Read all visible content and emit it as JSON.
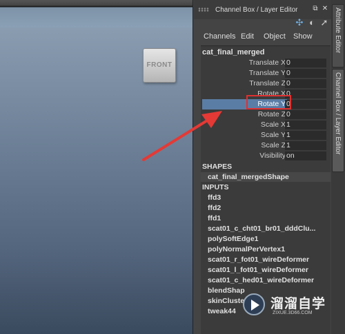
{
  "panel": {
    "title": "Channel Box / Layer Editor",
    "menus": [
      "Channels",
      "Edit",
      "Object",
      "Show"
    ]
  },
  "viewport": {
    "viewcube_label": "FRONT"
  },
  "channel_box": {
    "object_name": "cat_final_merged",
    "attributes": [
      {
        "label": "Translate X",
        "value": "0"
      },
      {
        "label": "Translate Y",
        "value": "0"
      },
      {
        "label": "Translate Z",
        "value": "0"
      },
      {
        "label": "Rotate X",
        "value": "0"
      },
      {
        "label": "Rotate Y",
        "value": "0"
      },
      {
        "label": "Rotate Z",
        "value": "0"
      },
      {
        "label": "Scale X",
        "value": "1"
      },
      {
        "label": "Scale Y",
        "value": "1"
      },
      {
        "label": "Scale Z",
        "value": "1"
      },
      {
        "label": "Visibility",
        "value": "on"
      }
    ],
    "shapes_header": "SHAPES",
    "shape_name": "cat_final_mergedShape",
    "inputs_header": "INPUTS",
    "inputs": [
      "ffd3",
      "ffd2",
      "ffd1",
      "scat01_c_cht01_br01_dddClu...",
      "polySoftEdge1",
      "polyNormalPerVertex1",
      "scat01_r_fot01_wireDeformer",
      "scat01_l_fot01_wireDeformer",
      "scat01_c_hed01_wireDeformer",
      "blendShap",
      "skinCluste",
      "tweak44"
    ]
  },
  "side_tabs": [
    "Attribute Editor",
    "Channel Box / Layer Editor"
  ],
  "watermark": {
    "brand": "溜溜自学",
    "url": "ZIXUE.3D66.COM"
  },
  "colors": {
    "selection": "#5a7da5",
    "highlight_box": "#e03030",
    "arrow": "#e53935"
  }
}
